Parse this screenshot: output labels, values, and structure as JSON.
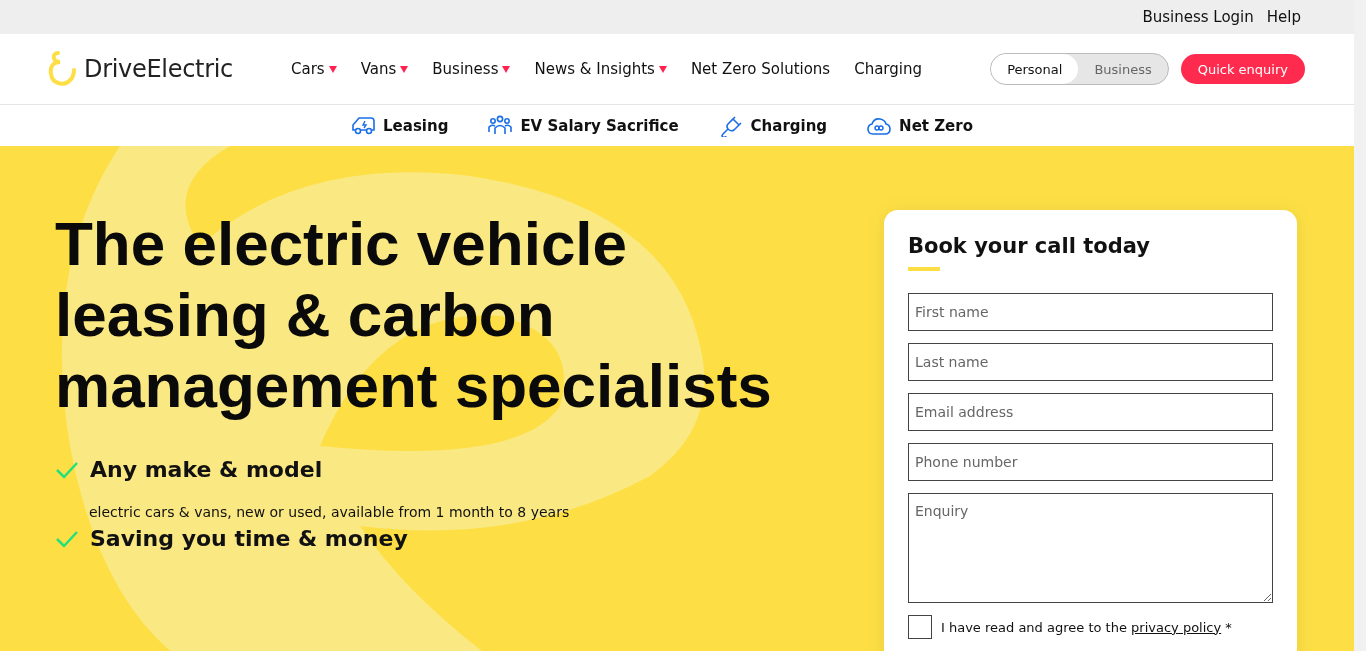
{
  "top_links": [
    "Business Login",
    "Help"
  ],
  "logo": {
    "text": "DriveElectric"
  },
  "nav": [
    {
      "label": "Cars",
      "dropdown": true
    },
    {
      "label": "Vans",
      "dropdown": true
    },
    {
      "label": "Business",
      "dropdown": true
    },
    {
      "label": "News & Insights",
      "dropdown": true
    },
    {
      "label": "Net Zero Solutions",
      "dropdown": false
    },
    {
      "label": "Charging",
      "dropdown": false
    }
  ],
  "audience_toggle": [
    {
      "label": "Personal",
      "selected": true
    },
    {
      "label": "Business",
      "selected": false
    }
  ],
  "cta_button": "Quick enquiry",
  "subnav": [
    {
      "label": "Leasing",
      "kind": "van"
    },
    {
      "label": "EV Salary Sacrifice",
      "kind": "people"
    },
    {
      "label": "Charging",
      "kind": "plug"
    },
    {
      "label": "Net Zero",
      "kind": "cloud"
    }
  ],
  "hero": {
    "heading": "The electric vehicle leasing & carbon management specialists",
    "features": [
      {
        "title": "Any make & model",
        "text": "electric cars & vans, new or used, available from 1 month to 8 years"
      },
      {
        "title": "Saving you time & money"
      }
    ]
  },
  "form": {
    "title": "Book your call today",
    "fields": [
      {
        "placeholder": "First name",
        "kind": "input"
      },
      {
        "placeholder": "Last name",
        "kind": "input"
      },
      {
        "placeholder": "Email address",
        "kind": "input"
      },
      {
        "placeholder": "Phone number",
        "kind": "input"
      },
      {
        "placeholder": "Enquiry",
        "kind": "textarea"
      }
    ],
    "consent": {
      "text": "I have read and agree to the",
      "link": "privacy policy",
      "suffix": "*",
      "checked": false
    }
  }
}
